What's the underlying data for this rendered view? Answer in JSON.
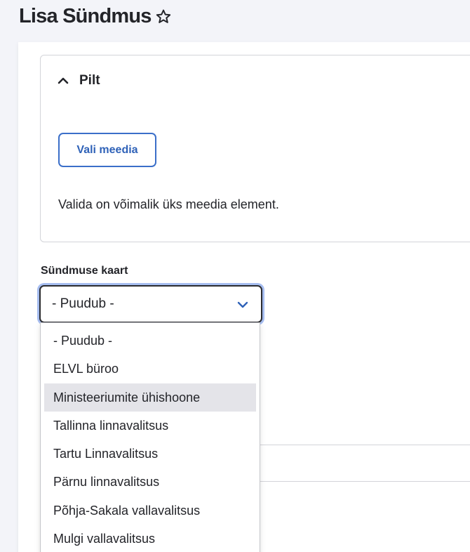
{
  "header": {
    "title": "Lisa Sündmus"
  },
  "media_section": {
    "title": "Pilt",
    "button_label": "Vali meedia",
    "description": "Valida on võimalik üks meedia element."
  },
  "map_field": {
    "label": "Sündmuse kaart",
    "selected_value": "- Puudub -",
    "options": [
      "- Puudub -",
      "ELVL büroo",
      "Ministeeriumite ühishoone",
      "Tallinna linnavalitsus",
      "Tartu Linnavalitsus",
      "Pärnu linnavalitsus",
      "Põhja-Sakala vallavalitsus",
      "Mulgi vallavalitsus"
    ],
    "highlighted_index": 2
  },
  "colors": {
    "accent": "#3b6fc9",
    "focus_ring": "#a6bdf0",
    "highlight": "#e4e4e9"
  }
}
